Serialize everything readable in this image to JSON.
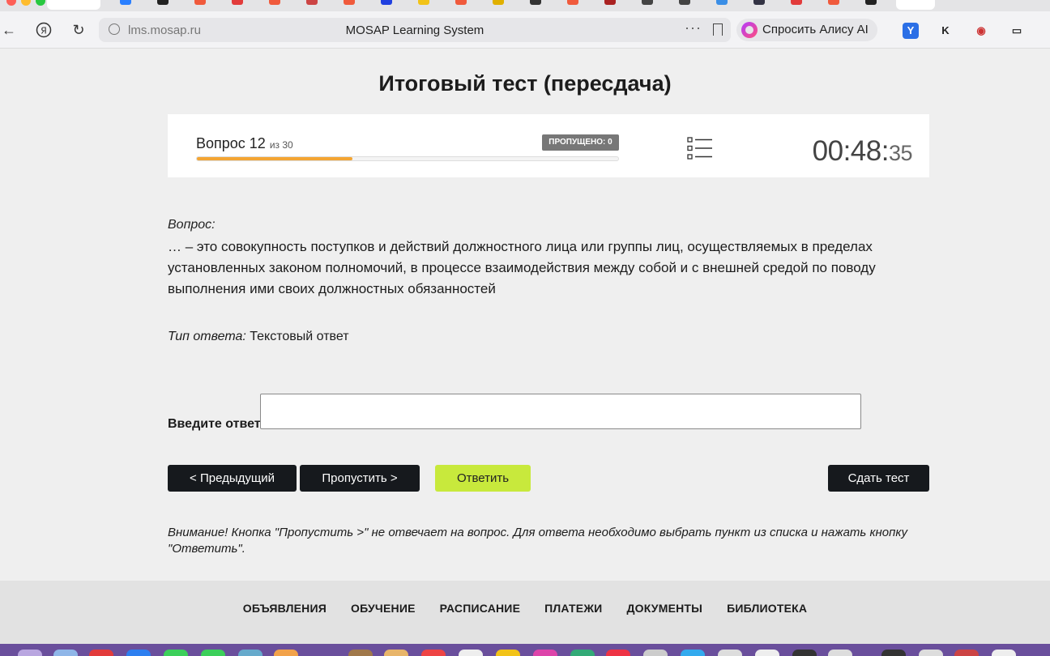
{
  "browser": {
    "url": "lms.mosap.ru",
    "page_title": "MOSAP Learning System",
    "alice_label": "Спросить Алису AI",
    "icons": [
      "back-icon",
      "yandex-icon",
      "reload-icon",
      "lock-icon",
      "more-icon",
      "bookmark-icon"
    ]
  },
  "test": {
    "title": "Итоговый тест (пересдача)",
    "question_prefix": "Вопрос 12",
    "question_of": "из 30",
    "progress_fraction": 0.37,
    "skipped_label": "ПРОПУЩЕНО: 0",
    "timer_main": "00:48:",
    "timer_seconds": "35"
  },
  "question": {
    "caption": "Вопрос:",
    "text": "… – это совокупность поступков и действий должностного лица или группы лиц, осуществляемых в пределах установленных законом полномочий, в процессе взаимодействия между собой и с внешней средой по поводу выполнения ими своих должностных обязанностей",
    "answer_type_label": "Тип ответа:",
    "answer_type_value": "Текстовый ответ",
    "answer_prompt": "Введите ответ:",
    "answer_value": ""
  },
  "buttons": {
    "prev": "< Предыдущий",
    "skip": "Пропустить >",
    "answer": "Ответить",
    "submit": "Сдать тест"
  },
  "warning": "Внимание! Кнопка \"Пропустить >\" не отвечает на вопрос. Для ответа необходимо выбрать пункт из списка и нажать кнопку \"Ответить\".",
  "footer": {
    "links": [
      "ОБЪЯВЛЕНИЯ",
      "ОБУЧЕНИЕ",
      "РАСПИСАНИЕ",
      "ПЛАТЕЖИ",
      "ДОКУМЕНТЫ",
      "БИБЛИОТЕКА"
    ]
  },
  "colors": {
    "progress": "#f4a533",
    "answer_button": "#c8e93c",
    "dark_button": "#16191d"
  }
}
